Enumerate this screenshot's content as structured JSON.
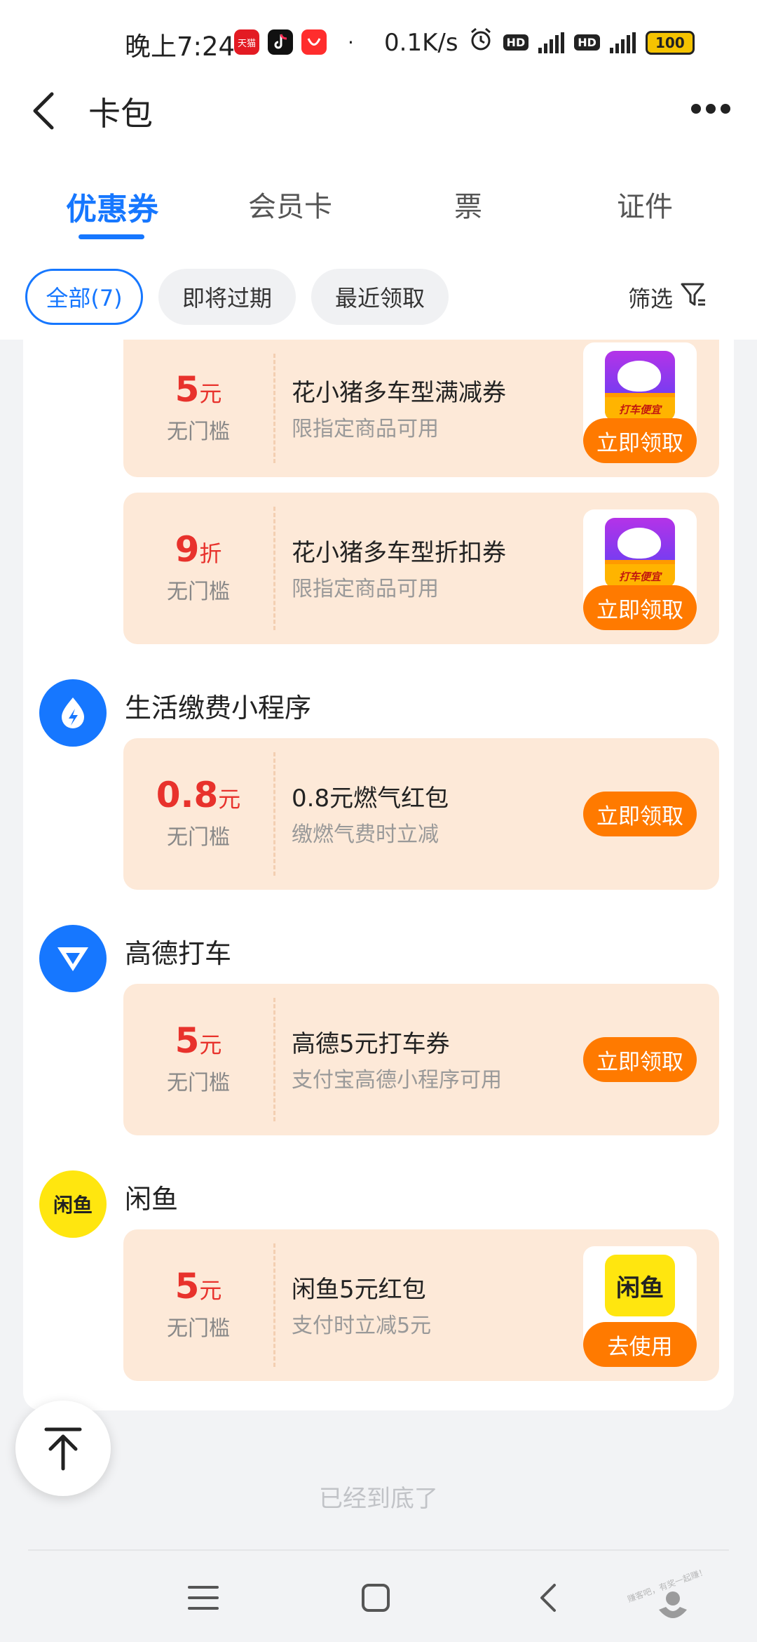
{
  "status_bar": {
    "time": "晚上7:24",
    "app_icons": [
      "天猫",
      "抖音",
      "拼"
    ],
    "dot": "·",
    "speed": "0.1K/s",
    "hd": "HD",
    "network": "4G",
    "battery": "100"
  },
  "header": {
    "title": "卡包"
  },
  "tabs": [
    {
      "label": "优惠券",
      "active": true
    },
    {
      "label": "会员卡",
      "active": false
    },
    {
      "label": "票",
      "active": false
    },
    {
      "label": "证件",
      "active": false
    }
  ],
  "chips": [
    {
      "label": "全部(7)",
      "active": true
    },
    {
      "label": "即将过期",
      "active": false
    },
    {
      "label": "最近领取",
      "active": false
    }
  ],
  "filter_label": "筛选",
  "groups": [
    {
      "title": "生活缴费小程序",
      "icon": "bolt-icon"
    },
    {
      "title": "高德打车",
      "icon": "amap-icon"
    },
    {
      "title": "闲鱼",
      "icon": "xianyu-icon",
      "icon_text": "闲鱼"
    }
  ],
  "coupons": [
    {
      "amount": "5",
      "unit": "元",
      "threshold": "无门槛",
      "title": "花小猪多车型满减券",
      "subtitle": "限指定商品可用",
      "button": "立即领取",
      "thumb_caption": "打车便宜"
    },
    {
      "amount": "9",
      "unit": "折",
      "threshold": "无门槛",
      "title": "花小猪多车型折扣券",
      "subtitle": "限指定商品可用",
      "button": "立即领取",
      "thumb_caption": "打车便宜"
    },
    {
      "amount": "0.8",
      "unit": "元",
      "threshold": "无门槛",
      "title": "0.8元燃气红包",
      "subtitle": "缴燃气费时立减",
      "button": "立即领取"
    },
    {
      "amount": "5",
      "unit": "元",
      "threshold": "无门槛",
      "title": "高德5元打车券",
      "subtitle": "支付宝高德小程序可用",
      "button": "立即领取"
    },
    {
      "amount": "5",
      "unit": "元",
      "threshold": "无门槛",
      "title": "闲鱼5元红包",
      "subtitle": "支付时立减5元",
      "button": "去使用",
      "thumb_text": "闲鱼"
    }
  ],
  "footer": {
    "end_text": "已经到底了",
    "watermark": "赚客吧，有奖一起赚！"
  },
  "colors": {
    "accent": "#1677ff",
    "coupon_bg": "#fde9d8",
    "amount": "#e8322c",
    "button": "#ff7a00"
  }
}
